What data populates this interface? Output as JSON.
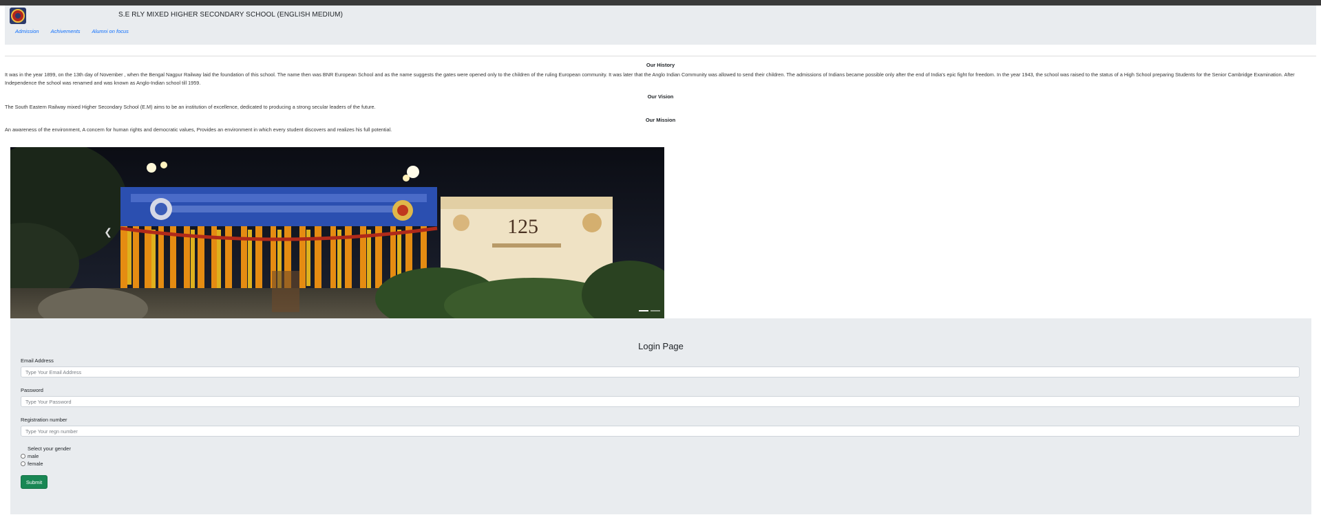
{
  "header": {
    "school_name": "S.E RLY MIXED HIGHER SECONDARY SCHOOL (ENGLISH MEDIUM)",
    "nav": [
      "Admission",
      "Achivements",
      "Alumni on focus"
    ]
  },
  "history": {
    "heading": "Our History",
    "text": "It was in the year 1899, on the 13th day of November , when the Bengal Nagpur Railway laid the foundation of this school. The name then was BNR European School and as the name suggests the gates were opened only to the children of the ruling European community. It was later that the Anglo Indian Community was allowed to send their children. The admissions of Indians became possible only after the end of India's epic fight for freedom. In the year 1943, the school was raised to the status of a High School preparing Students for the Senior Cambridge Examination. After Independence the school was renamed and was known as Anglo-Indian school till 1959."
  },
  "vision": {
    "heading": "Our Vision",
    "text": "The South Eastern Railway mixed Higher Secondary School (E.M) aims to be an institution of excellence, dedicated to producing a strong secular leaders of the future."
  },
  "mission": {
    "heading": "Our Mission",
    "text": "An awareness of the environment, A concern for human rights and democratic values, Provides an environment in which every student discovers and realizes his full potential."
  },
  "carousel": {
    "banner_number": "125",
    "prev_icon": "chevron-left-icon",
    "slide_count": 2,
    "active_slide": 1
  },
  "login": {
    "title": "Login Page",
    "email_label": "Email Address",
    "email_placeholder": "Type Your Email Address",
    "password_label": "Password",
    "password_placeholder": "Type Your Password",
    "reg_label": "Registration number",
    "reg_placeholder": "Type Your regn number",
    "gender_label": "Select your gender",
    "gender_options": [
      "male",
      "female"
    ],
    "submit_label": "Submit"
  },
  "colors": {
    "header_bg": "#e9ecef",
    "link": "#0d6efd",
    "submit": "#198754"
  }
}
